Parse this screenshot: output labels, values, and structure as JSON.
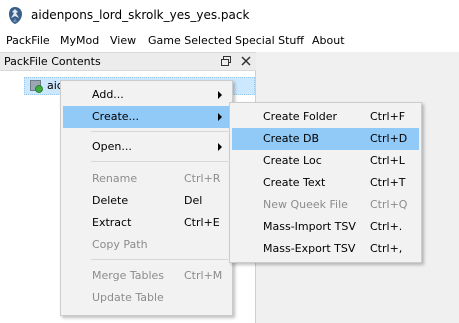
{
  "window": {
    "title": "aidenpons_lord_skrolk_yes_yes.pack"
  },
  "menubar": {
    "items": [
      "PackFile",
      "MyMod",
      "View",
      "Game Selected",
      "Special Stuff",
      "About"
    ]
  },
  "dock": {
    "title": "PackFile Contents",
    "tree_item_label": "aic"
  },
  "context_menu": {
    "items": [
      {
        "label": "Add...",
        "submenu": true,
        "enabled": true
      },
      {
        "label": "Create...",
        "submenu": true,
        "enabled": true,
        "highlighted": true
      },
      {
        "label": "Open...",
        "submenu": true,
        "enabled": true
      },
      {
        "label": "Rename",
        "shortcut": "Ctrl+R",
        "enabled": false
      },
      {
        "label": "Delete",
        "shortcut": "Del",
        "enabled": true
      },
      {
        "label": "Extract",
        "shortcut": "Ctrl+E",
        "enabled": true
      },
      {
        "label": "Copy Path",
        "enabled": false
      },
      {
        "label": "Merge Tables",
        "shortcut": "Ctrl+M",
        "enabled": false
      },
      {
        "label": "Update Table",
        "enabled": false
      }
    ]
  },
  "create_submenu": {
    "items": [
      {
        "label": "Create Folder",
        "shortcut": "Ctrl+F",
        "enabled": true
      },
      {
        "label": "Create DB",
        "shortcut": "Ctrl+D",
        "enabled": true,
        "highlighted": true
      },
      {
        "label": "Create Loc",
        "shortcut": "Ctrl+L",
        "enabled": true
      },
      {
        "label": "Create Text",
        "shortcut": "Ctrl+T",
        "enabled": true
      },
      {
        "label": "New Queek File",
        "shortcut": "Ctrl+Q",
        "enabled": false
      },
      {
        "label": "Mass-Import TSV",
        "shortcut": "Ctrl+.",
        "enabled": true
      },
      {
        "label": "Mass-Export TSV",
        "shortcut": "Ctrl+,",
        "enabled": true
      }
    ]
  },
  "colors": {
    "menu_highlight": "#91c9f7",
    "tree_selection": "#cce8ff",
    "disabled_text": "#8c8c8c"
  }
}
